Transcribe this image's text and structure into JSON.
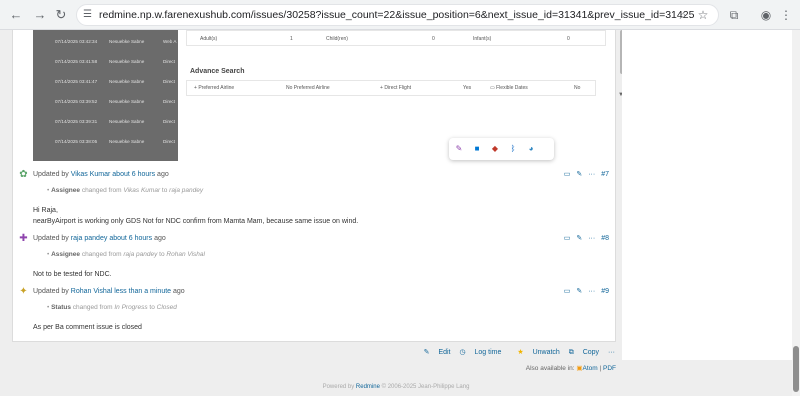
{
  "browser": {
    "url": "redmine.np.w.farenexushub.com/issues/30258?issue_count=22&issue_position=6&next_issue_id=31341&prev_issue_id=31425"
  },
  "embedded_screenshot": {
    "rows": [
      {
        "date": "07/14/2025 03:42:34",
        "name": "Nesuebke Sabne",
        "extra": "Web A"
      },
      {
        "date": "07/14/2025 03:41:58",
        "name": "Nesuebke Sabne",
        "extra": "Direct"
      },
      {
        "date": "07/14/2025 03:41:47",
        "name": "Nesuebke Sabne",
        "extra": "Direct"
      },
      {
        "date": "07/14/2025 03:39:52",
        "name": "Nesuebke Sabne",
        "extra": "Direct"
      },
      {
        "date": "07/14/2025 03:39:31",
        "name": "Nesuebke Sabne",
        "extra": "Direct"
      },
      {
        "date": "07/14/2025 03:38:05",
        "name": "Nesuebke Sabne",
        "extra": "Direct"
      }
    ],
    "pax": {
      "adult_label": "Adult(s)",
      "adult_value": "1",
      "child_label": "Child(ren)",
      "child_value": "0",
      "infant_label": "Infant(s)",
      "infant_value": "0"
    },
    "advanced_search_title": "Advance Search",
    "search_row": {
      "preferred_airline_label": "Preferred Airline",
      "preferred_airline_value": "No Preferred Airline",
      "direct_flight_label": "Direct Flight",
      "direct_flight_value": "Yes",
      "flexible_dates_label": "Flexible Dates",
      "flexible_dates_value": "No"
    }
  },
  "journals": [
    {
      "prefix": "Updated by",
      "author": "Vikas Kumar",
      "time": "about 6 hours",
      "suffix": "ago",
      "number": "#7",
      "detail_field": "Assignee",
      "detail_changed": "changed from",
      "detail_from": "Vikas Kumar",
      "detail_to_word": "to",
      "detail_to": "raja pandey",
      "notes": [
        "Hi Raja,",
        "nearByAirport is working only GDS Not for NDC confirm from Mamta Mam, because same issue on wind."
      ]
    },
    {
      "prefix": "Updated by",
      "author": "raja pandey",
      "time": "about 6 hours",
      "suffix": "ago",
      "number": "#8",
      "detail_field": "Assignee",
      "detail_changed": "changed from",
      "detail_from": "raja pandey",
      "detail_to_word": "to",
      "detail_to": "Rohan Vishal",
      "notes": [
        "Not to be tested for NDC."
      ]
    },
    {
      "prefix": "Updated by",
      "author": "Rohan Vishal",
      "time": "less than a minute",
      "suffix": "ago",
      "number": "#9",
      "detail_field": "Status",
      "detail_changed": "changed from",
      "detail_from": "In Progress",
      "detail_to_word": "to",
      "detail_to": "Closed",
      "notes": [
        "As per Ba comment issue is closed"
      ]
    }
  ],
  "actions": {
    "edit": "Edit",
    "log_time": "Log time",
    "unwatch": "Unwatch",
    "copy": "Copy",
    "more": "···"
  },
  "other_formats": {
    "label": "Also available in:",
    "atom": "Atom",
    "separator": "|",
    "pdf": "PDF"
  },
  "footer": {
    "prefix": "Powered by",
    "link": "Redmine",
    "suffix": "© 2006-2025 Jean-Philippe Lang"
  }
}
